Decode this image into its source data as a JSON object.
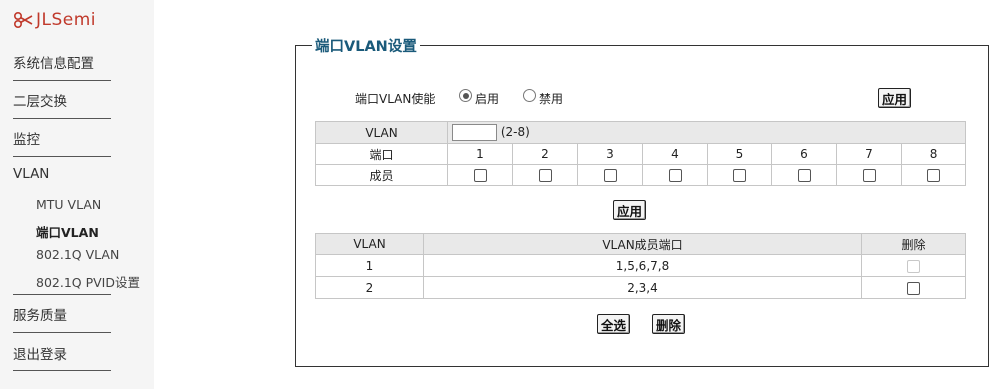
{
  "brand": {
    "name": "JLSemi",
    "logo_icon": "jlsemi-logo-icon",
    "color": "#c0392b"
  },
  "sidebar": {
    "items": [
      {
        "label": "系统信息配置"
      },
      {
        "label": "二层交换"
      },
      {
        "label": "监控"
      },
      {
        "label": "VLAN"
      },
      {
        "label": "服务质量"
      },
      {
        "label": "退出登录"
      }
    ],
    "vlan_sub": [
      {
        "label": "MTU VLAN",
        "active": false
      },
      {
        "label": "端口VLAN",
        "active": true
      },
      {
        "label": "802.1Q VLAN",
        "active": false
      },
      {
        "label": "802.1Q PVID设置",
        "active": false
      }
    ]
  },
  "panel": {
    "title": "端口VLAN设置",
    "enable": {
      "label": "端口VLAN使能",
      "options": [
        {
          "label": "启用",
          "selected": true
        },
        {
          "label": "禁用",
          "selected": false
        }
      ],
      "apply_label": "应用"
    },
    "config": {
      "vlan_label": "VLAN",
      "vlan_value": "",
      "vlan_range": "(2-8)",
      "port_label": "端口",
      "member_label": "成员",
      "ports": [
        "1",
        "2",
        "3",
        "4",
        "5",
        "6",
        "7",
        "8"
      ],
      "apply_label": "应用"
    },
    "list": {
      "headers": {
        "vlan": "VLAN",
        "members": "VLAN成员端口",
        "delete": "删除"
      },
      "rows": [
        {
          "vlan": "1",
          "members": "1,5,6,7,8",
          "delete_disabled": true
        },
        {
          "vlan": "2",
          "members": "2,3,4",
          "delete_disabled": false
        }
      ],
      "select_all_label": "全选",
      "delete_label": "删除"
    }
  }
}
